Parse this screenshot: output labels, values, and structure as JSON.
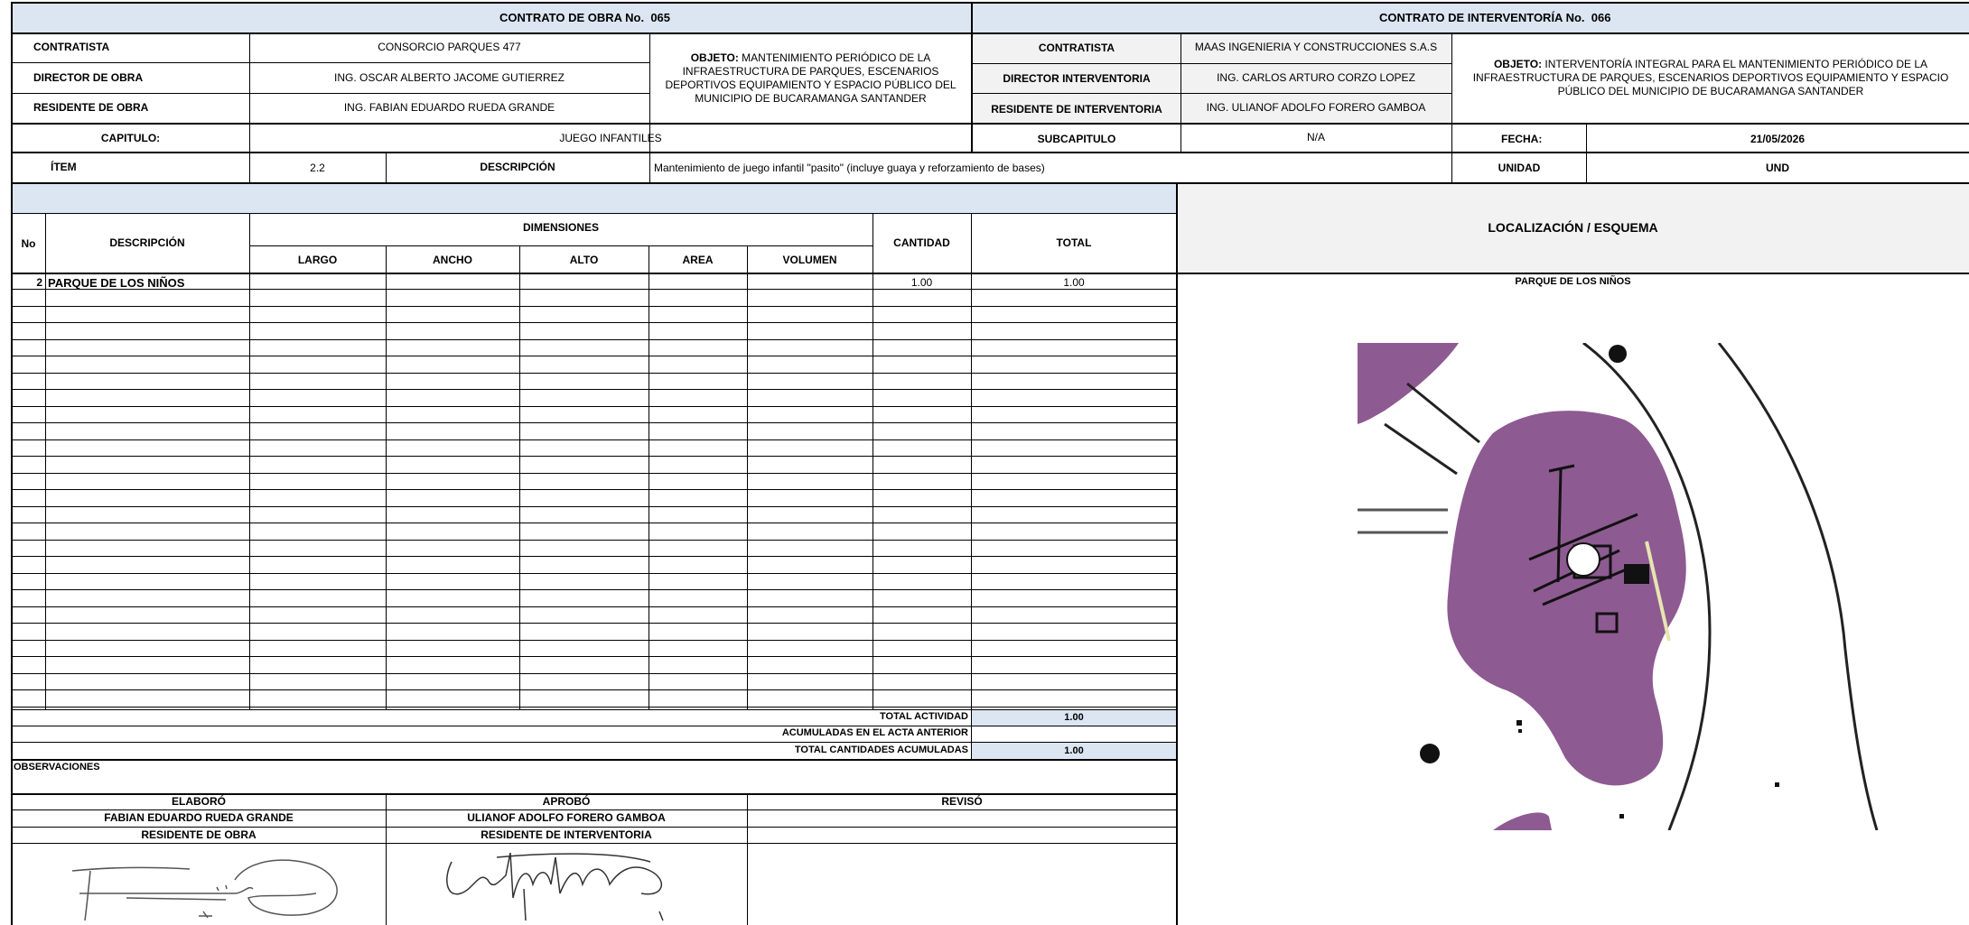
{
  "obra": {
    "contract_label": "CONTRATO DE OBRA No.",
    "contract_no": "065",
    "contratista_label": "CONTRATISTA",
    "contratista": "CONSORCIO PARQUES 477",
    "director_label": "DIRECTOR DE OBRA",
    "director": "ING. OSCAR ALBERTO JACOME GUTIERREZ",
    "residente_label": "RESIDENTE DE OBRA",
    "residente": "ING. FABIAN EDUARDO RUEDA GRANDE",
    "objeto_label": "OBJETO:",
    "objeto": "MANTENIMIENTO PERIÓDICO DE LA INFRAESTRUCTURA DE PARQUES, ESCENARIOS DEPORTIVOS EQUIPAMIENTO Y ESPACIO PÚBLICO DEL MUNICIPIO DE BUCARAMANGA SANTANDER"
  },
  "interventoria": {
    "contract_label": "CONTRATO DE INTERVENTORÍA No.",
    "contract_no": "066",
    "contratista_label": "CONTRATISTA",
    "contratista": "MAAS INGENIERIA Y CONSTRUCCIONES S.A.S",
    "director_label": "DIRECTOR INTERVENTORIA",
    "director": "ING. CARLOS ARTURO CORZO LOPEZ",
    "residente_label": "RESIDENTE DE INTERVENTORIA",
    "residente": "ING. ULIANOF ADOLFO FORERO GAMBOA",
    "objeto_label": "OBJETO:",
    "objeto": "INTERVENTORÍA INTEGRAL PARA EL MANTENIMIENTO PERIÓDICO DE LA INFRAESTRUCTURA DE PARQUES, ESCENARIOS DEPORTIVOS EQUIPAMIENTO Y ESPACIO PÚBLICO DEL MUNICIPIO DE BUCARAMANGA SANTANDER"
  },
  "capitulo": {
    "label": "CAPITULO:",
    "value": "JUEGO INFANTILES",
    "sub_label": "SUBCAPITULO",
    "sub_value": "N/A",
    "fecha_label": "FECHA:",
    "fecha": "21/05/2026"
  },
  "item": {
    "label": "ÍTEM",
    "value": "2.2",
    "desc_label": "DESCRIPCIÓN",
    "desc": "Mantenimiento de juego infantil \"pasito\" (incluye guaya y reforzamiento de bases)",
    "unidad_label": "UNIDAD",
    "unidad": "UND"
  },
  "table": {
    "h_no": "No",
    "h_desc": "DESCRIPCIÓN",
    "h_dims": "DIMENSIONES",
    "h_largo": "LARGO",
    "h_ancho": "ANCHO",
    "h_alto": "ALTO",
    "h_area": "AREA",
    "h_volumen": "VOLUMEN",
    "h_cantidad": "CANTIDAD",
    "h_total": "TOTAL",
    "row_no": "2",
    "row_desc": "PARQUE DE LOS NIÑOS",
    "row_cantidad": "1.00",
    "row_total": "1.00"
  },
  "totals": {
    "actividad_label": "TOTAL ACTIVIDAD",
    "actividad": "1.00",
    "anterior_label": "ACUMULADAS EN EL ACTA ANTERIOR",
    "acumuladas_label": "TOTAL CANTIDADES ACUMULADAS",
    "acumuladas": "1.00"
  },
  "observaciones_label": "OBSERVACIONES",
  "firmas": {
    "elaboro_label": "ELABORÓ",
    "elaboro_name": "FABIAN EDUARDO RUEDA GRANDE",
    "elaboro_role": "RESIDENTE DE OBRA",
    "aprobo_label": "APROBÓ",
    "aprobo_name": "ULIANOF ADOLFO  FORERO GAMBOA",
    "aprobo_role": "RESIDENTE DE INTERVENTORIA",
    "reviso_label": "REVISÓ"
  },
  "localizacion": {
    "title": "LOCALIZACIÓN  / ESQUEMA",
    "caption": "PARQUE DE LOS NIÑOS"
  },
  "colors": {
    "header_fill": "#dce6f2",
    "map_fill": "#8e5a92"
  }
}
